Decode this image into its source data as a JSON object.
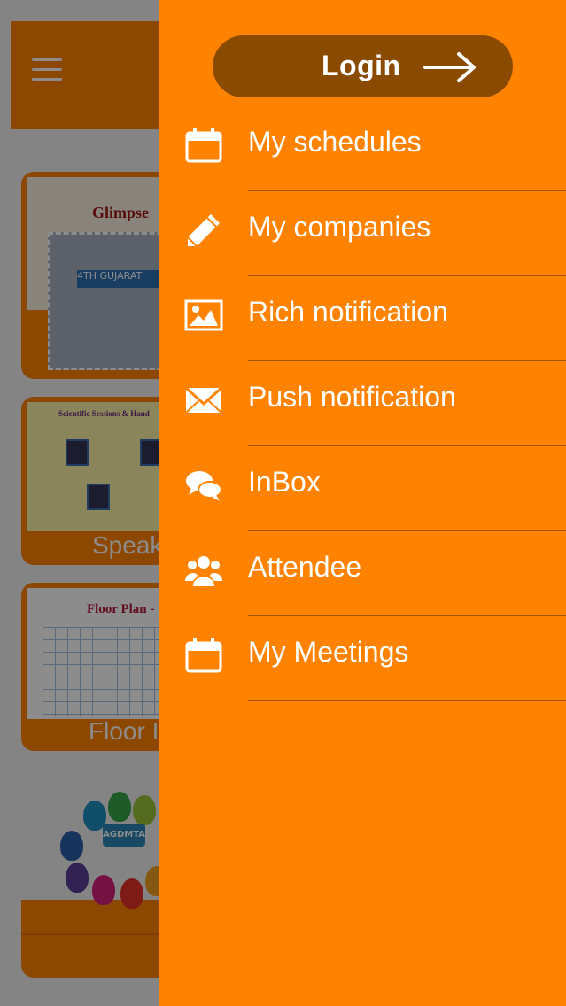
{
  "background_app": {
    "menu_icon": "hamburger-icon",
    "cards": [
      {
        "label": "",
        "image_title": "Glimpse",
        "image_banner": "4TH GUJARAT"
      },
      {
        "label": "Speak",
        "image_title": "Scientific Sessions & Hand"
      },
      {
        "label": "Floor I",
        "image_title": "Floor Plan - "
      },
      {
        "label": "",
        "logo_text": "AGDMTA"
      }
    ]
  },
  "drawer": {
    "login": {
      "label": "Login",
      "icon": "arrow-right-icon"
    },
    "items": [
      {
        "label": "My schedules",
        "icon": "calendar-icon"
      },
      {
        "label": "My companies",
        "icon": "pencil-icon"
      },
      {
        "label": "Rich notification",
        "icon": "picture-icon"
      },
      {
        "label": "Push notification",
        "icon": "envelope-icon"
      },
      {
        "label": "InBox",
        "icon": "chat-bubbles-icon"
      },
      {
        "label": "Attendee",
        "icon": "users-icon"
      },
      {
        "label": "My Meetings",
        "icon": "calendar-icon"
      }
    ]
  },
  "colors": {
    "drawer": "#ff8200",
    "login_button": "#8a4b00",
    "text": "#ffffff"
  }
}
